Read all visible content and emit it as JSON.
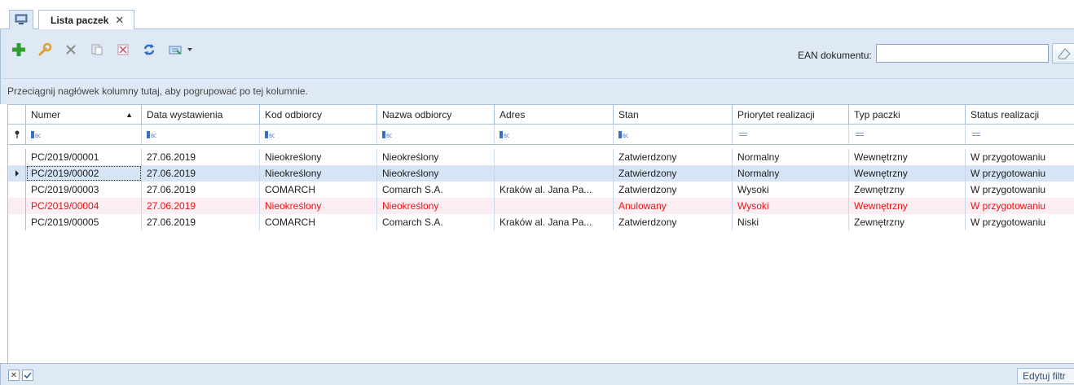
{
  "tabs": {
    "home_icon": "monitor-icon",
    "active_title": "Lista paczek",
    "close_glyph": "✕"
  },
  "toolbar": {
    "buttons": [
      "add",
      "edit",
      "delete",
      "copy",
      "cancel",
      "refresh",
      "export"
    ],
    "ean_label": "EAN dokumentu:",
    "ean_value": ""
  },
  "group_panel": {
    "text": "Przeciągnij nagłówek kolumny tutaj, aby pogrupować po tej kolumnie."
  },
  "grid": {
    "columns": [
      "Numer",
      "Data wystawienia",
      "Kod odbiorcy",
      "Nazwa odbiorcy",
      "Adres",
      "Stan",
      "Priorytet realizacji",
      "Typ paczki",
      "Status realizacji"
    ],
    "sorted_column": "Numer",
    "sort_direction": "ascending",
    "rows": [
      [
        "PC/2019/00001",
        "27.06.2019",
        "Nieokreślony",
        "Nieokreślony",
        "",
        "Zatwierdzony",
        "Normalny",
        "Wewnętrzny",
        "W przygotowaniu"
      ],
      [
        "PC/2019/00002",
        "27.06.2019",
        "Nieokreślony",
        "Nieokreślony",
        "",
        "Zatwierdzony",
        "Normalny",
        "Wewnętrzny",
        "W przygotowaniu"
      ],
      [
        "PC/2019/00003",
        "27.06.2019",
        "COMARCH",
        "Comarch S.A.",
        "Kraków al. Jana Pa...",
        "Zatwierdzony",
        "Wysoki",
        "Zewnętrzny",
        "W przygotowaniu"
      ],
      [
        "PC/2019/00004",
        "27.06.2019",
        "Nieokreślony",
        "Nieokreślony",
        "",
        "Anulowany",
        "Wysoki",
        "Wewnętrzny",
        "W przygotowaniu"
      ],
      [
        "PC/2019/00005",
        "27.06.2019",
        "COMARCH",
        "Comarch S.A.",
        "Kraków al. Jana Pa...",
        "Zatwierdzony",
        "Niski",
        "Zewnętrzny",
        "W przygotowaniu"
      ]
    ],
    "selected_row": 1,
    "cancelled_row": 3
  },
  "footer": {
    "edit_filter_label": "Edytuj filtr"
  },
  "colors": {
    "panel_bg": "#dfe9f5",
    "border": "#a9c0da",
    "selected_row": "#d6e5f6",
    "cancelled_text": "#ee1111",
    "add_icon": "#2e9e2e"
  }
}
